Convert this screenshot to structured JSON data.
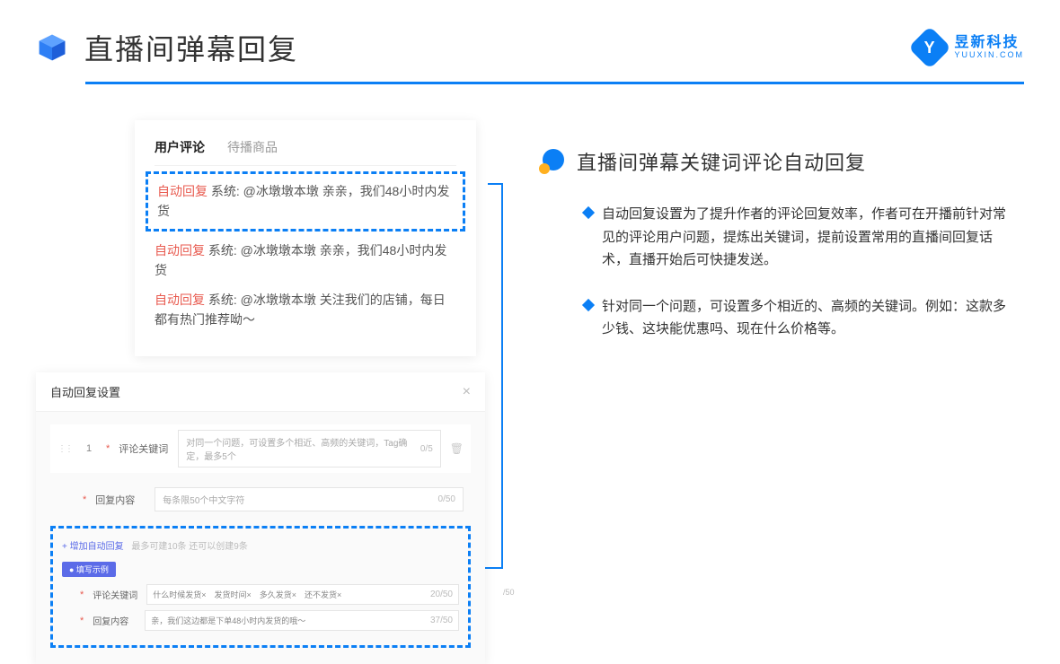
{
  "header": {
    "title": "直播间弹幕回复",
    "brand_name": "昱新科技",
    "brand_sub": "YUUXIN.COM"
  },
  "comments_card": {
    "tab_active": "用户评论",
    "tab_inactive": "待播商品",
    "rows": [
      {
        "prefix": "自动回复",
        "body": "系统: @冰墩墩本墩 亲亲，我们48小时内发货"
      },
      {
        "prefix": "自动回复",
        "body": "系统: @冰墩墩本墩 亲亲，我们48小时内发货"
      },
      {
        "prefix": "自动回复",
        "body": "系统: @冰墩墩本墩 关注我们的店铺，每日都有热门推荐呦～"
      }
    ]
  },
  "settings_card": {
    "title": "自动回复设置",
    "idx": "1",
    "label_keyword": "评论关键词",
    "placeholder_keyword": "对同一个问题，可设置多个相近、高频的关键词，Tag确定，最多5个",
    "count_keyword": "0/5",
    "label_content": "回复内容",
    "placeholder_content": "每条限50个中文字符",
    "count_content": "0/50",
    "add_link": "+ 增加自动回复",
    "add_tip": "最多可建10条 还可以创建9条",
    "example_badge": "● 填写示例",
    "ex_label_keyword": "评论关键词",
    "ex_tags": "什么时候发货×　发货时间×　多久发货×　还不发货×",
    "ex_count_keyword": "20/50",
    "ex_label_content": "回复内容",
    "ex_content": "亲，我们这边都是下单48小时内发货的哦～",
    "ex_count_content": "37/50",
    "stray_count": "/50"
  },
  "right": {
    "section_title": "直播间弹幕关键词评论自动回复",
    "bullets": [
      "自动回复设置为了提升作者的评论回复效率，作者可在开播前针对常见的评论用户问题，提炼出关键词，提前设置常用的直播间回复话术，直播开始后可快捷发送。",
      "针对同一个问题，可设置多个相近的、高频的关键词。例如：这款多少钱、这块能优惠吗、现在什么价格等。"
    ]
  }
}
